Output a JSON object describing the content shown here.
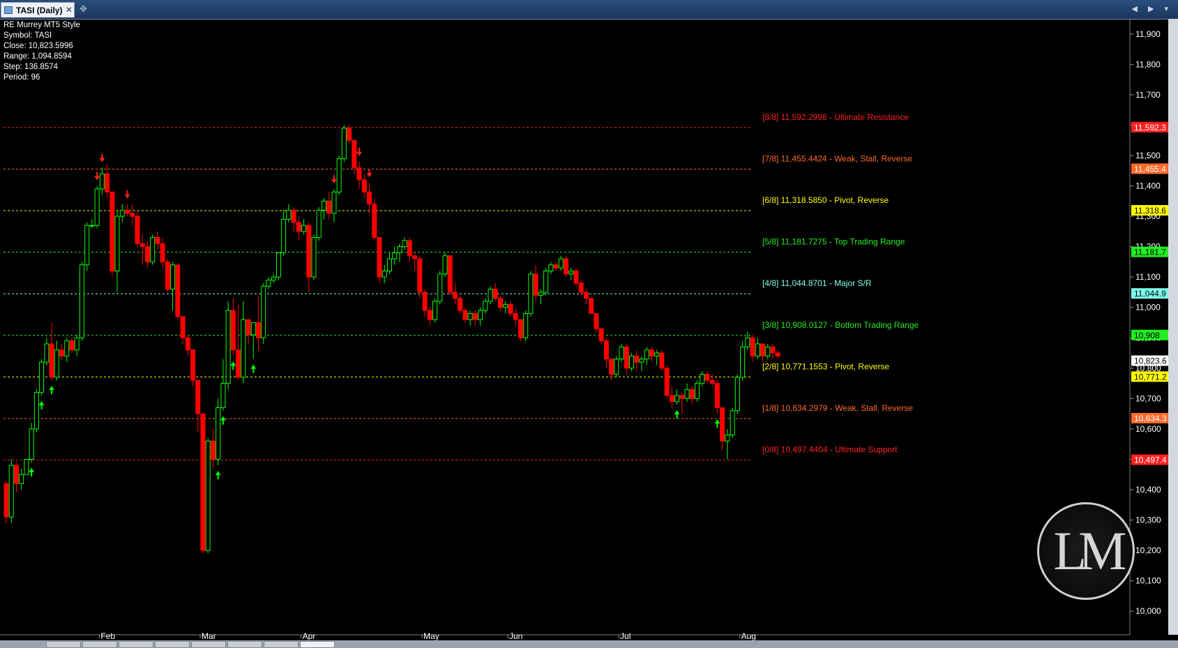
{
  "window": {
    "tab_title": "TASI (Daily)",
    "close_glyph": "✕",
    "pin_icon": "pin-icon",
    "controls": "◀ ▶ ▾"
  },
  "info": {
    "study": "RE Murrey MT5 Style",
    "symbol": "Symbol: TASI",
    "close": "Close: 10,823.5996",
    "range": "Range: 1,094.8594",
    "step": "Step: 136.8574",
    "period": "Period: 96"
  },
  "logo": {
    "text": "LM"
  },
  "chart_data": {
    "type": "candlestick",
    "ylim": [
      9950,
      11950
    ],
    "y_ticks": [
      "10,000",
      "10,100",
      "10,200",
      "10,300",
      "10,400",
      "10,500",
      "10,600",
      "10,700",
      "10,800",
      "10,900",
      "11,000",
      "11,100",
      "11,200",
      "11,300",
      "11,400",
      "11,500",
      "11,600",
      "11,700",
      "11,800",
      "11,900"
    ],
    "x_labels": [
      "Feb",
      "Mar",
      "Apr",
      "May",
      "Jun",
      "Jul",
      "Aug"
    ],
    "x_label_index": [
      19,
      39,
      59,
      83,
      100,
      122,
      146
    ],
    "current_price": {
      "label": "10,823.6",
      "value": 10823.5996
    },
    "murrey_levels": [
      {
        "name": "8/8",
        "value": 11592.2998,
        "text": "[8/8] 11,592.2998 - Ultimate Resistance",
        "axis_label": "11,592.3",
        "color": "#ff2020"
      },
      {
        "name": "7/8",
        "value": 11455.4424,
        "text": "[7/8] 11,455.4424 - Weak, Stall, Reverse",
        "axis_label": "11,455.4",
        "color": "#ff6a2a"
      },
      {
        "name": "6/8",
        "value": 11318.585,
        "text": "[6/8] 11,318.5850 - Pivot, Reverse",
        "axis_label": "11,318.6",
        "color": "#ffff00"
      },
      {
        "name": "5/8",
        "value": 11181.7275,
        "text": "[5/8] 11,181.7275 - Top Trading Range",
        "axis_label": "11,181.7",
        "color": "#22ee22"
      },
      {
        "name": "4/8",
        "value": 11044.8701,
        "text": "[4/8] 11,044.8701 - Major S/R",
        "axis_label": "11,044.9",
        "color": "#7fffee"
      },
      {
        "name": "3/8",
        "value": 10908.0127,
        "text": "[3/8] 10,908.0127 - Bottom Trading Range",
        "axis_label": "10,908",
        "color": "#22ee22"
      },
      {
        "name": "2/8",
        "value": 10771.1553,
        "text": "[2/8] 10,771.1553 - Pivot, Reverse",
        "axis_label": "10,771.2",
        "color": "#ffff00"
      },
      {
        "name": "1/8",
        "value": 10634.2979,
        "text": "[1/8] 10,634.2979 - Weak, Stall, Reverse",
        "axis_label": "10,634.3",
        "color": "#ff6a2a"
      },
      {
        "name": "0/8",
        "value": 10497.4404,
        "text": "[0/8] 10,497.4404 - Ultimate Support",
        "axis_label": "10,497.4",
        "color": "#ff2020"
      }
    ],
    "candles": [
      [
        10420,
        10430,
        10290,
        10310
      ],
      [
        10310,
        10500,
        10290,
        10480
      ],
      [
        10480,
        10490,
        10390,
        10420
      ],
      [
        10420,
        10470,
        10400,
        10450
      ],
      [
        10450,
        10500,
        10490,
        10500
      ],
      [
        10500,
        10620,
        10490,
        10600
      ],
      [
        10600,
        10730,
        10590,
        10720
      ],
      [
        10720,
        10830,
        10710,
        10820
      ],
      [
        10820,
        10900,
        10810,
        10880
      ],
      [
        10880,
        10950,
        10760,
        10770
      ],
      [
        10770,
        10890,
        10760,
        10860
      ],
      [
        10860,
        10880,
        10830,
        10840
      ],
      [
        10840,
        10900,
        10820,
        10890
      ],
      [
        10890,
        10900,
        10850,
        10860
      ],
      [
        10860,
        10910,
        10840,
        10900
      ],
      [
        10900,
        11150,
        10890,
        11140
      ],
      [
        11140,
        11280,
        11120,
        11270
      ],
      [
        11270,
        11290,
        11260,
        11270
      ],
      [
        11270,
        11400,
        11260,
        11390
      ],
      [
        11390,
        11460,
        11370,
        11440
      ],
      [
        11440,
        11470,
        11360,
        11380
      ],
      [
        11380,
        11340,
        11100,
        11120
      ],
      [
        11120,
        11320,
        11050,
        11300
      ],
      [
        11300,
        11340,
        11280,
        11320
      ],
      [
        11320,
        11340,
        11300,
        11310
      ],
      [
        11310,
        11340,
        11270,
        11300
      ],
      [
        11300,
        11320,
        11200,
        11210
      ],
      [
        11210,
        11240,
        11140,
        11200
      ],
      [
        11200,
        11220,
        11130,
        11150
      ],
      [
        11150,
        11240,
        11140,
        11230
      ],
      [
        11230,
        11250,
        11190,
        11210
      ],
      [
        11210,
        11230,
        11130,
        11150
      ],
      [
        11150,
        11160,
        11050,
        11060
      ],
      [
        11060,
        11150,
        10990,
        11140
      ],
      [
        11140,
        11140,
        10960,
        10970
      ],
      [
        10970,
        10950,
        10880,
        10900
      ],
      [
        10900,
        10910,
        10840,
        10860
      ],
      [
        10860,
        10850,
        10740,
        10760
      ],
      [
        10760,
        10710,
        10590,
        10650
      ],
      [
        10650,
        10350,
        10190,
        10200
      ],
      [
        10200,
        10570,
        10190,
        10560
      ],
      [
        10560,
        10600,
        10470,
        10500
      ],
      [
        10500,
        10700,
        10480,
        10670
      ],
      [
        10670,
        10830,
        10660,
        10750
      ],
      [
        10750,
        11020,
        10730,
        10990
      ],
      [
        10990,
        11030,
        10840,
        10860
      ],
      [
        10860,
        11010,
        10760,
        10770
      ],
      [
        10770,
        11020,
        10750,
        10960
      ],
      [
        10960,
        10950,
        10880,
        10910
      ],
      [
        10910,
        10950,
        10830,
        10950
      ],
      [
        10950,
        11040,
        10860,
        10900
      ],
      [
        10900,
        11080,
        10880,
        11070
      ],
      [
        11070,
        11100,
        11060,
        11090
      ],
      [
        11090,
        11110,
        11080,
        11100
      ],
      [
        11100,
        11180,
        11090,
        11180
      ],
      [
        11180,
        11320,
        11170,
        11290
      ],
      [
        11290,
        11340,
        11280,
        11320
      ],
      [
        11320,
        11330,
        11250,
        11280
      ],
      [
        11280,
        11300,
        11220,
        11250
      ],
      [
        11250,
        11290,
        11240,
        11270
      ],
      [
        11270,
        11280,
        11050,
        11100
      ],
      [
        11100,
        11240,
        11090,
        11230
      ],
      [
        11230,
        11330,
        11220,
        11320
      ],
      [
        11320,
        11360,
        11290,
        11350
      ],
      [
        11350,
        11380,
        11290,
        11310
      ],
      [
        11310,
        11390,
        11280,
        11380
      ],
      [
        11380,
        11500,
        11370,
        11490
      ],
      [
        11490,
        11600,
        11480,
        11590
      ],
      [
        11590,
        11600,
        11540,
        11550
      ],
      [
        11550,
        11500,
        11440,
        11460
      ],
      [
        11460,
        11480,
        11390,
        11420
      ],
      [
        11420,
        11440,
        11360,
        11380
      ],
      [
        11380,
        11410,
        11310,
        11340
      ],
      [
        11340,
        11360,
        11220,
        11230
      ],
      [
        11230,
        11210,
        11080,
        11100
      ],
      [
        11100,
        11140,
        11080,
        11120
      ],
      [
        11120,
        11180,
        11110,
        11160
      ],
      [
        11160,
        11200,
        11140,
        11180
      ],
      [
        11180,
        11210,
        11150,
        11200
      ],
      [
        11200,
        11230,
        11190,
        11220
      ],
      [
        11220,
        11230,
        11150,
        11170
      ],
      [
        11170,
        11180,
        11120,
        11160
      ],
      [
        11160,
        11170,
        11030,
        11050
      ],
      [
        11050,
        11060,
        10970,
        10990
      ],
      [
        10990,
        11000,
        10940,
        10960
      ],
      [
        10960,
        11030,
        10950,
        11020
      ],
      [
        11020,
        11120,
        11010,
        11110
      ],
      [
        11110,
        11180,
        11100,
        11170
      ],
      [
        11170,
        11160,
        11040,
        11050
      ],
      [
        11050,
        11080,
        11010,
        11030
      ],
      [
        11030,
        11040,
        10980,
        10990
      ],
      [
        10990,
        11000,
        10950,
        10960
      ],
      [
        10960,
        10990,
        10940,
        10980
      ],
      [
        10980,
        10990,
        10940,
        10960
      ],
      [
        10960,
        11000,
        10940,
        10990
      ],
      [
        10990,
        11030,
        10980,
        11020
      ],
      [
        11020,
        11070,
        11010,
        11060
      ],
      [
        11060,
        11080,
        11020,
        11030
      ],
      [
        11030,
        11040,
        10990,
        11000
      ],
      [
        11000,
        11020,
        10980,
        11010
      ],
      [
        11010,
        11020,
        10970,
        10980
      ],
      [
        10980,
        11000,
        10940,
        10960
      ],
      [
        10960,
        10950,
        10890,
        10900
      ],
      [
        10900,
        10990,
        10890,
        10980
      ],
      [
        10980,
        11120,
        10970,
        11110
      ],
      [
        11110,
        11140,
        11020,
        11040
      ],
      [
        11040,
        11060,
        11010,
        11050
      ],
      [
        11050,
        11130,
        11040,
        11120
      ],
      [
        11120,
        11150,
        11110,
        11140
      ],
      [
        11140,
        11150,
        11120,
        11130
      ],
      [
        11130,
        11170,
        11120,
        11160
      ],
      [
        11160,
        11170,
        11100,
        11110
      ],
      [
        11110,
        11130,
        11090,
        11120
      ],
      [
        11120,
        11130,
        11070,
        11080
      ],
      [
        11080,
        11090,
        11040,
        11050
      ],
      [
        11050,
        11060,
        11010,
        11030
      ],
      [
        11030,
        11020,
        10980,
        10980
      ],
      [
        10980,
        10970,
        10920,
        10930
      ],
      [
        10930,
        10920,
        10880,
        10890
      ],
      [
        10890,
        10900,
        10800,
        10830
      ],
      [
        10830,
        10820,
        10760,
        10780
      ],
      [
        10780,
        10840,
        10770,
        10830
      ],
      [
        10830,
        10880,
        10820,
        10870
      ],
      [
        10870,
        10880,
        10780,
        10800
      ],
      [
        10800,
        10850,
        10790,
        10840
      ],
      [
        10840,
        10860,
        10790,
        10820
      ],
      [
        10820,
        10840,
        10790,
        10830
      ],
      [
        10830,
        10870,
        10810,
        10860
      ],
      [
        10860,
        10870,
        10820,
        10840
      ],
      [
        10840,
        10860,
        10810,
        10850
      ],
      [
        10850,
        10860,
        10790,
        10800
      ],
      [
        10800,
        10810,
        10700,
        10710
      ],
      [
        10710,
        10740,
        10670,
        10690
      ],
      [
        10690,
        10730,
        10680,
        10710
      ],
      [
        10710,
        10720,
        10650,
        10700
      ],
      [
        10700,
        10750,
        10690,
        10730
      ],
      [
        10730,
        10740,
        10680,
        10700
      ],
      [
        10700,
        10760,
        10690,
        10750
      ],
      [
        10750,
        10790,
        10740,
        10780
      ],
      [
        10780,
        10790,
        10750,
        10760
      ],
      [
        10760,
        10780,
        10740,
        10750
      ],
      [
        10750,
        10760,
        10650,
        10670
      ],
      [
        10670,
        10640,
        10530,
        10560
      ],
      [
        10560,
        10600,
        10500,
        10580
      ],
      [
        10580,
        10670,
        10570,
        10660
      ],
      [
        10660,
        10780,
        10650,
        10770
      ],
      [
        10770,
        10890,
        10760,
        10870
      ],
      [
        10870,
        10920,
        10860,
        10900
      ],
      [
        10900,
        10910,
        10820,
        10840
      ],
      [
        10840,
        10900,
        10830,
        10880
      ],
      [
        10880,
        10870,
        10820,
        10840
      ],
      [
        10840,
        10880,
        10830,
        10870
      ],
      [
        10870,
        10880,
        10830,
        10850
      ],
      [
        10850,
        10860,
        10830,
        10840
      ]
    ],
    "markers": [
      {
        "i": 5,
        "dir": "up"
      },
      {
        "i": 7,
        "dir": "up"
      },
      {
        "i": 9,
        "dir": "up"
      },
      {
        "i": 18,
        "dir": "down"
      },
      {
        "i": 19,
        "dir": "down"
      },
      {
        "i": 24,
        "dir": "down"
      },
      {
        "i": 42,
        "dir": "up"
      },
      {
        "i": 43,
        "dir": "up"
      },
      {
        "i": 45,
        "dir": "up"
      },
      {
        "i": 49,
        "dir": "up"
      },
      {
        "i": 65,
        "dir": "down"
      },
      {
        "i": 70,
        "dir": "down"
      },
      {
        "i": 72,
        "dir": "down"
      },
      {
        "i": 133,
        "dir": "up"
      },
      {
        "i": 141,
        "dir": "up"
      }
    ]
  }
}
